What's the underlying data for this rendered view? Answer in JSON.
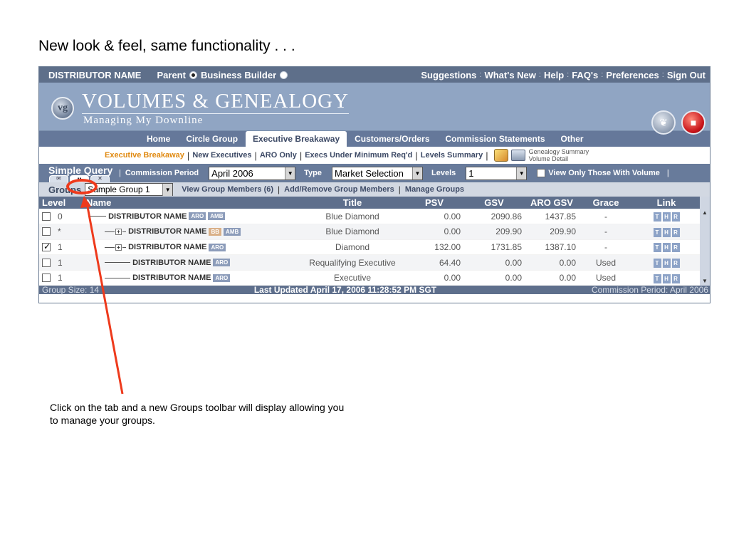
{
  "slide": {
    "title": "New look & feel, same functionality . . .",
    "annotation": "Click on the tab and a new Groups toolbar will display allowing you to manage your groups."
  },
  "topbar": {
    "distributor": "DISTRIBUTOR NAME",
    "parent_label": "Parent",
    "bb_label": "Business Builder",
    "links": [
      "Suggestions",
      "What's New",
      "Help",
      "FAQ's",
      "Preferences",
      "Sign Out"
    ]
  },
  "banner": {
    "logo": "vg",
    "title": "VOLUMES & GENEALOGY",
    "subtitle": "Managing My Downline"
  },
  "nav": {
    "tabs": [
      "Home",
      "Circle Group",
      "Executive Breakaway",
      "Customers/Orders",
      "Commission Statements",
      "Other"
    ]
  },
  "subnav": {
    "links": [
      "Executive Breakaway",
      "New Executives",
      "ARO Only",
      "Execs Under Minimum Req'd",
      "Levels Summary"
    ],
    "genealogy_summary": "Genealogy Summary",
    "volume_detail": "Volume Detail"
  },
  "query": {
    "title": "Simple Query",
    "commission_label": "Commission Period",
    "commission_value": "April 2006",
    "type_label": "Type",
    "type_value": "Market Selection",
    "levels_label": "Levels",
    "levels_value": "1",
    "volume_check_label": "View Only Those With Volume"
  },
  "groups": {
    "label": "Groups",
    "selected": "Sample Group 1",
    "view_members": "View Group Members (6)",
    "add_remove": "Add/Remove Group Members",
    "manage": "Manage Groups"
  },
  "table": {
    "headers": [
      "Level",
      "Name",
      "Title",
      "PSV",
      "GSV",
      "ARO GSV",
      "Grace",
      "Link"
    ],
    "rows": [
      {
        "level": "0",
        "name": "DISTRIBUTOR NAME",
        "tags": [
          "ARO",
          "AMB"
        ],
        "title": "Blue Diamond",
        "psv": "0.00",
        "gsv": "2090.86",
        "aro_gsv": "1437.85",
        "grace": "-",
        "checked": false
      },
      {
        "level": "*",
        "name": "DISTRIBUTOR NAME",
        "tags": [
          "BB",
          "AMB"
        ],
        "title": "Blue Diamond",
        "psv": "0.00",
        "gsv": "209.90",
        "aro_gsv": "209.90",
        "grace": "-",
        "checked": false
      },
      {
        "level": "1",
        "name": "DISTRIBUTOR NAME",
        "tags": [
          "ARO"
        ],
        "title": "Diamond",
        "psv": "132.00",
        "gsv": "1731.85",
        "aro_gsv": "1387.10",
        "grace": "-",
        "checked": true
      },
      {
        "level": "1",
        "name": "DISTRIBUTOR NAME",
        "tags": [
          "ARO"
        ],
        "title": "Requalifying Executive",
        "psv": "64.40",
        "gsv": "0.00",
        "aro_gsv": "0.00",
        "grace": "Used",
        "checked": false
      },
      {
        "level": "1",
        "name": "DISTRIBUTOR NAME",
        "tags": [
          "ARO"
        ],
        "title": "Executive",
        "psv": "0.00",
        "gsv": "0.00",
        "aro_gsv": "0.00",
        "grace": "Used",
        "checked": false
      }
    ],
    "link_buttons": [
      "T",
      "H",
      "R"
    ]
  },
  "status": {
    "group_size": "Group Size: 14",
    "last_updated": "Last Updated April 17, 2006 11:28:52 PM SGT",
    "commission_period": "Commission Period: April 2006"
  },
  "colors": {
    "accent_orange": "#e08a12",
    "header_blue": "#5e6f8a",
    "banner_blue": "#90a5c3",
    "annotation_red": "#ee3a1c"
  }
}
